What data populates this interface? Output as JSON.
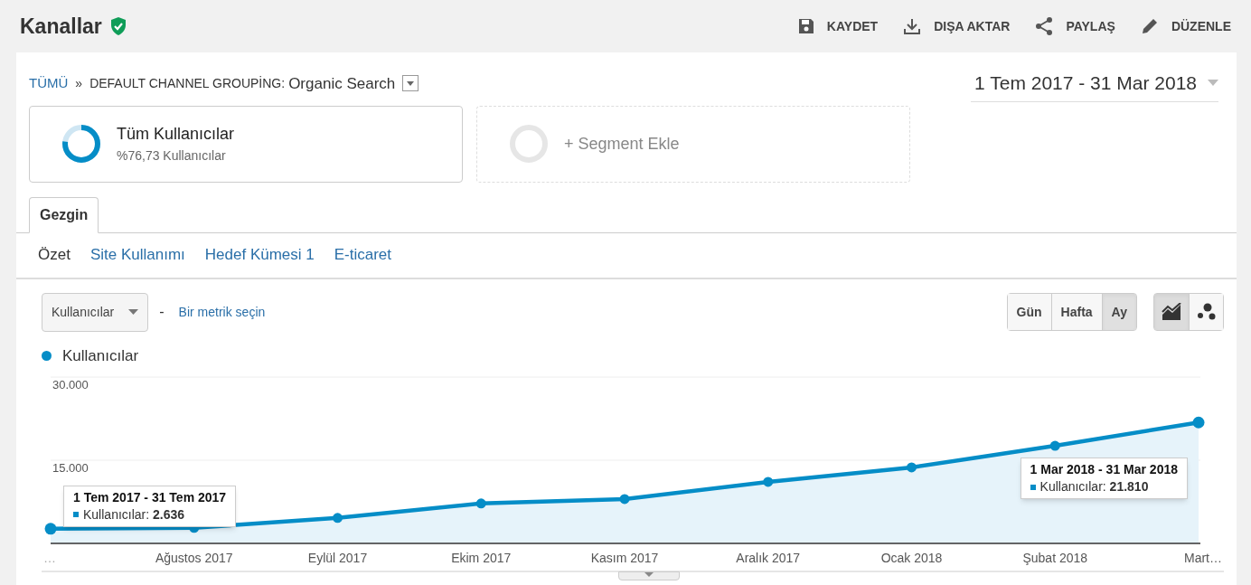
{
  "header": {
    "title": "Kanallar",
    "actions": [
      {
        "kind": "save",
        "label": "KAYDET"
      },
      {
        "kind": "export",
        "label": "DIŞA AKTAR"
      },
      {
        "kind": "share",
        "label": "PAYLAŞ"
      },
      {
        "kind": "edit",
        "label": "DÜZENLE"
      }
    ]
  },
  "breadcrumb": {
    "root": "TÜMÜ",
    "separator": "»",
    "group": "DEFAULT CHANNEL GROUPİNG:",
    "value": "Organic Search"
  },
  "date_range": "1 Tem 2017 - 31 Mar 2018",
  "segments": [
    {
      "kind": "active",
      "title": "Tüm Kullanıcılar",
      "subtitle": "%76,73 Kullanıcılar",
      "level": 0.7673
    },
    {
      "kind": "add",
      "title": "+ Segment Ekle"
    }
  ],
  "tabs": [
    {
      "label": "Gezgin",
      "selected": true
    }
  ],
  "subtabs": [
    {
      "label": "Özet",
      "selected": true
    },
    {
      "label": "Site Kullanımı",
      "selected": false
    },
    {
      "label": "Hedef Kümesi 1",
      "selected": false
    },
    {
      "label": "E-ticaret",
      "selected": false
    }
  ],
  "metric_select": {
    "value": "Kullanıcılar",
    "separator": "-",
    "link": "Bir metrik seçin"
  },
  "intervals": [
    {
      "label": "Gün",
      "selected": false
    },
    {
      "label": "Hafta",
      "selected": false
    },
    {
      "label": "Ay",
      "selected": true
    }
  ],
  "chart_types": [
    {
      "kind": "line",
      "selected": true
    },
    {
      "kind": "motion",
      "selected": false
    }
  ],
  "chart": {
    "chart_data": {
      "type": "area",
      "categories": [
        "…",
        "Ağustos 2017",
        "Eylül 2017",
        "Ekim 2017",
        "Kasım 2017",
        "Aralık 2017",
        "Ocak 2018",
        "Şubat 2018",
        "Mart…"
      ],
      "series": [
        {
          "name": "Kullanıcılar",
          "color": "#058dc7",
          "values": [
            2636,
            2800,
            4600,
            7200,
            8000,
            11100,
            13700,
            17600,
            21810
          ]
        }
      ],
      "ylim": [
        0,
        30000
      ],
      "yticks": [
        {
          "value": 15000,
          "label": "15.000"
        },
        {
          "value": 30000,
          "label": "30.000"
        }
      ]
    },
    "tooltips": [
      {
        "title": "1 Tem 2017 - 31 Tem 2017",
        "text": "Kullanıcılar: **2.636**"
      },
      {
        "title": "1 Mar 2018 - 31 Mar 2018",
        "text": "Kullanıcılar: **21.810**"
      }
    ]
  }
}
